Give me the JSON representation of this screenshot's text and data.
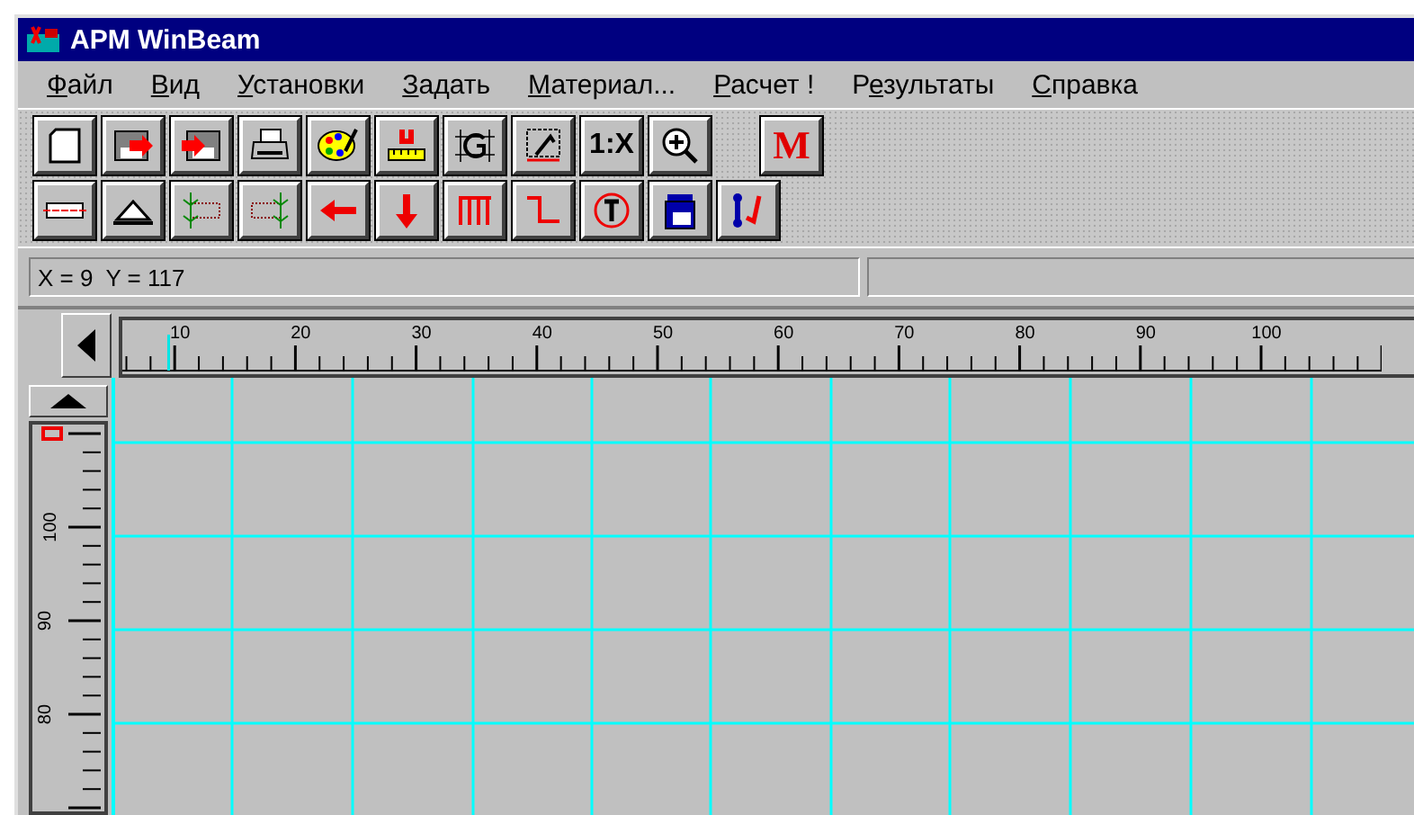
{
  "window": {
    "title": "APM WinBeam"
  },
  "menu": [
    {
      "key": "Ф",
      "after": "айл"
    },
    {
      "key": "В",
      "after": "ид"
    },
    {
      "key": "У",
      "after": "становки"
    },
    {
      "key": "З",
      "after": "адать"
    },
    {
      "key": "М",
      "after": "атериал..."
    },
    {
      "key": "Р",
      "after": "асчет !"
    },
    {
      "before": "Р",
      "key": "е",
      "after": "зультаты"
    },
    {
      "key": "С",
      "after": "правка"
    }
  ],
  "toolbar": [
    [
      {
        "kind": "new"
      },
      {
        "kind": "save"
      },
      {
        "kind": "open"
      },
      {
        "kind": "print"
      },
      {
        "kind": "palette"
      },
      {
        "kind": "units"
      },
      {
        "kind": "grid"
      },
      {
        "kind": "scale"
      },
      {
        "kind": "text",
        "label": "1:X"
      },
      {
        "kind": "zoom"
      },
      {
        "kind": "gap"
      },
      {
        "kind": "mark",
        "label": "M"
      }
    ],
    [
      {
        "kind": "beam"
      },
      {
        "kind": "support"
      },
      {
        "kind": "section-left"
      },
      {
        "kind": "section-right"
      },
      {
        "kind": "arrow-left"
      },
      {
        "kind": "arrow-down"
      },
      {
        "kind": "distributed"
      },
      {
        "kind": "step"
      },
      {
        "kind": "torque"
      },
      {
        "kind": "block"
      },
      {
        "kind": "dumbbell"
      }
    ]
  ],
  "status": {
    "coordinates": "X = 9  Y = 117"
  },
  "ruler": {
    "labels": [
      "10",
      "20",
      "30",
      "40",
      "50",
      "60",
      "70",
      "80",
      "90",
      "100"
    ]
  },
  "vertical_ruler": {
    "labels": [
      "100",
      "90",
      "80"
    ]
  }
}
